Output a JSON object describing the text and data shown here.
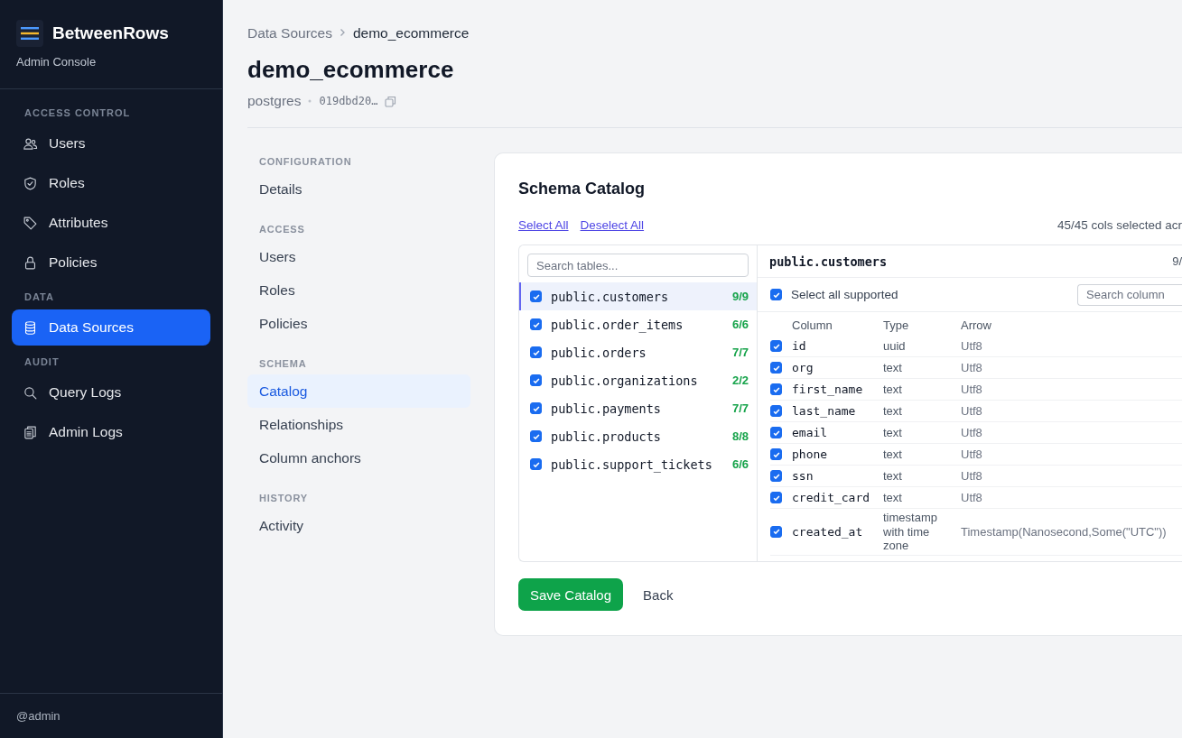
{
  "sidebar": {
    "brand": "BetweenRows",
    "subtitle": "Admin Console",
    "sections": [
      {
        "heading": "ACCESS CONTROL",
        "items": [
          {
            "label": "Users",
            "selected": false
          },
          {
            "label": "Roles",
            "selected": false
          },
          {
            "label": "Attributes",
            "selected": false
          },
          {
            "label": "Policies",
            "selected": false
          }
        ]
      },
      {
        "heading": "DATA",
        "items": [
          {
            "label": "Data Sources",
            "selected": true
          }
        ]
      },
      {
        "heading": "AUDIT",
        "items": [
          {
            "label": "Query Logs",
            "selected": false
          },
          {
            "label": "Admin Logs",
            "selected": false
          }
        ]
      }
    ],
    "user": "@admin"
  },
  "breadcrumb": [
    "Data Sources",
    "demo_ecommerce"
  ],
  "title": "demo_ecommerce",
  "engine": "postgres",
  "id": "019dbd20…",
  "subnav": [
    {
      "heading": "CONFIGURATION",
      "items": [
        {
          "label": "Details",
          "selected": false
        }
      ]
    },
    {
      "heading": "ACCESS",
      "items": [
        {
          "label": "Users",
          "selected": false
        },
        {
          "label": "Roles",
          "selected": false
        },
        {
          "label": "Policies",
          "selected": false
        }
      ]
    },
    {
      "heading": "SCHEMA",
      "items": [
        {
          "label": "Catalog",
          "selected": true
        },
        {
          "label": "Relationships",
          "selected": false
        },
        {
          "label": "Column anchors",
          "selected": false
        }
      ]
    },
    {
      "heading": "HISTORY",
      "items": [
        {
          "label": "Activity",
          "selected": false
        }
      ]
    }
  ],
  "catalog": {
    "title": "Schema Catalog",
    "links": [
      "Select All",
      "Deselect All"
    ],
    "summary": "45/45 cols selected acr",
    "table_search": {
      "placeholder": "Search tables..."
    },
    "tables": [
      {
        "name": "public.customers",
        "count": "9/9",
        "checked": true,
        "selected": true
      },
      {
        "name": "public.order_items",
        "count": "6/6",
        "checked": true,
        "selected": false
      },
      {
        "name": "public.orders",
        "count": "7/7",
        "checked": true,
        "selected": false
      },
      {
        "name": "public.organizations",
        "count": "2/2",
        "checked": true,
        "selected": false
      },
      {
        "name": "public.payments",
        "count": "7/7",
        "checked": true,
        "selected": false
      },
      {
        "name": "public.products",
        "count": "8/8",
        "checked": true,
        "selected": false
      },
      {
        "name": "public.support_tickets",
        "count": "6/6",
        "checked": true,
        "selected": false
      }
    ],
    "detail": {
      "table": "public.customers",
      "count": "9/",
      "select_all": {
        "label": "Select all supported",
        "checked": true
      },
      "column_search": {
        "placeholder": "Search column"
      },
      "columns": [
        "Column",
        "Type",
        "Arrow"
      ],
      "rows": [
        {
          "name": "id",
          "type": "uuid",
          "arrow": "Utf8",
          "checked": true
        },
        {
          "name": "org",
          "type": "text",
          "arrow": "Utf8",
          "checked": true
        },
        {
          "name": "first_name",
          "type": "text",
          "arrow": "Utf8",
          "checked": true
        },
        {
          "name": "last_name",
          "type": "text",
          "arrow": "Utf8",
          "checked": true
        },
        {
          "name": "email",
          "type": "text",
          "arrow": "Utf8",
          "checked": true
        },
        {
          "name": "phone",
          "type": "text",
          "arrow": "Utf8",
          "checked": true
        },
        {
          "name": "ssn",
          "type": "text",
          "arrow": "Utf8",
          "checked": true
        },
        {
          "name": "credit_card",
          "type": "text",
          "arrow": "Utf8",
          "checked": true
        },
        {
          "name": "created_at",
          "type": "timestamp with time zone",
          "arrow": "Timestamp(Nanosecond,Some(\"UTC\"))",
          "checked": true
        }
      ]
    },
    "buttons": [
      "Save Catalog",
      "Back"
    ]
  }
}
